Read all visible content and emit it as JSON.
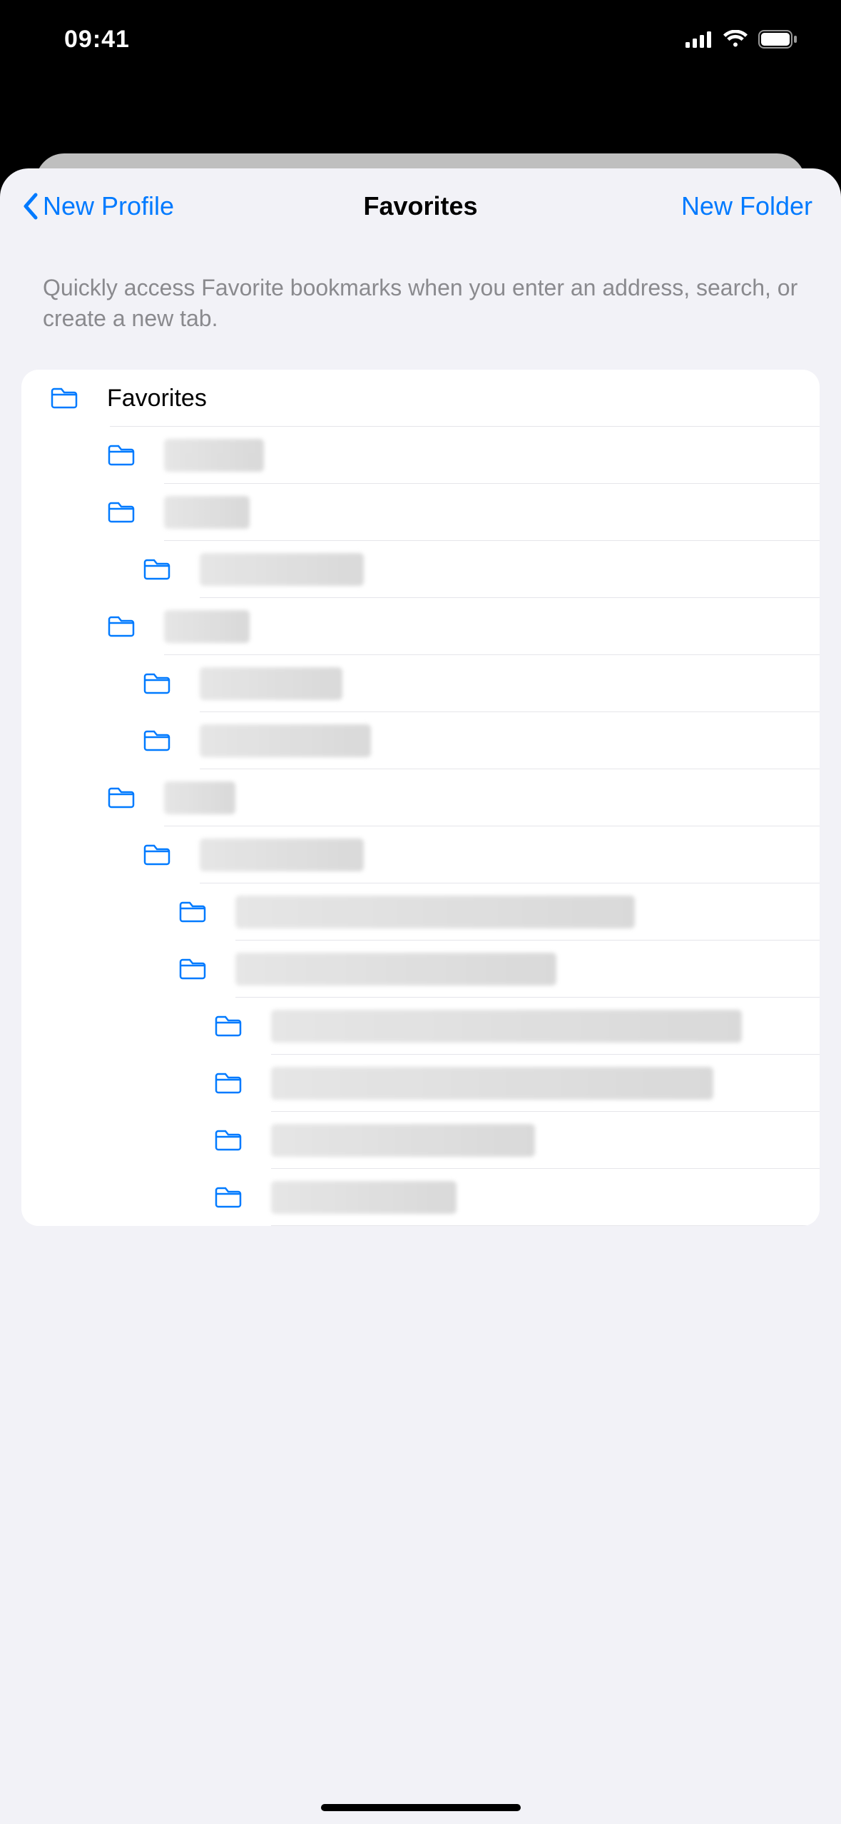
{
  "status": {
    "time": "09:41"
  },
  "nav": {
    "back_label": "New Profile",
    "title": "Favorites",
    "right_label": "New Folder"
  },
  "description": "Quickly access Favorite bookmarks when you enter an address, search, or create a new tab.",
  "root_folder_label": "Favorites",
  "items": [
    {
      "depth": 1,
      "blur_width": 140
    },
    {
      "depth": 1,
      "blur_width": 120
    },
    {
      "depth": 2,
      "blur_width": 230
    },
    {
      "depth": 1,
      "blur_width": 120
    },
    {
      "depth": 2,
      "blur_width": 200
    },
    {
      "depth": 2,
      "blur_width": 240
    },
    {
      "depth": 1,
      "blur_width": 100
    },
    {
      "depth": 2,
      "blur_width": 230
    },
    {
      "depth": 3,
      "blur_width": 560
    },
    {
      "depth": 3,
      "blur_width": 450
    },
    {
      "depth": 4,
      "blur_width": 660
    },
    {
      "depth": 4,
      "blur_width": 620
    },
    {
      "depth": 4,
      "blur_width": 370
    },
    {
      "depth": 4,
      "blur_width": 260
    }
  ]
}
